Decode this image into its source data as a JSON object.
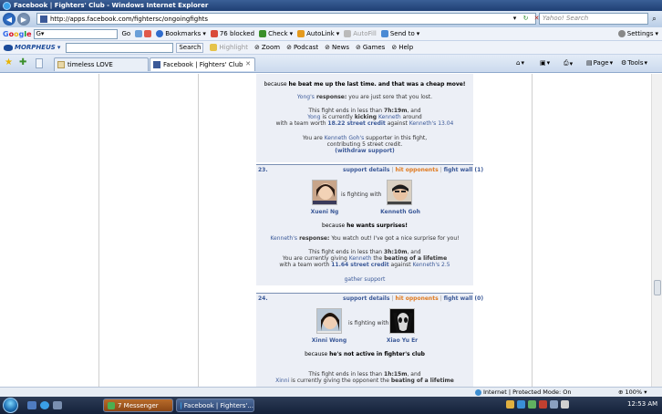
{
  "window": {
    "title": "Facebook | Fighters' Club - Windows Internet Explorer"
  },
  "address_bar": {
    "url": "http://apps.facebook.com/fightersc/ongoingfights",
    "search_placeholder": "Yahoo! Search"
  },
  "google_toolbar": {
    "go_label": "Go",
    "bookmarks_label": "Bookmarks",
    "blocked_label": "76 blocked",
    "check_label": "Check",
    "autolink_label": "AutoLink",
    "autofill_label": "AutoFill",
    "sendto_label": "Send to",
    "settings_label": "Settings"
  },
  "morpheus_toolbar": {
    "brand": "MORPHEUS",
    "search_label": "Search",
    "highlight_label": "Highlight",
    "zoom_label": "Zoom",
    "podcast_label": "Podcast",
    "news_label": "News",
    "games_label": "Games",
    "help_label": "Help"
  },
  "tabs": [
    {
      "label": "timeless LOVE"
    },
    {
      "label": "Facebook | Fighters' Club"
    }
  ],
  "command_bar": {
    "page_label": "Page",
    "tools_label": "Tools"
  },
  "entry22": {
    "reason_prefix": "because ",
    "reason": "he beat me up the last time. and that was a cheap move!",
    "responder": "Yong's",
    "response_label": " response:",
    "response_text": " you are just sore that you lost.",
    "ends_prefix": "This fight ends in less than ",
    "ends_time": "7h:19m",
    "ends_suffix": ", and",
    "fighter": "Yong",
    "mid1": " is currently ",
    "action": "kicking",
    "opponent": " Kenneth",
    "tail": " around",
    "team_prefix": "with a team worth ",
    "credit": "18.22 street credit",
    "against": " against ",
    "opp_credit": "Kenneth's 13.04",
    "supporter_prefix": "You are ",
    "supporter_of": "Kenneth Goh's",
    "supporter_suffix": " supporter in this fight,",
    "contributing": "contributing 5 street credit.",
    "withdraw_label": "(withdraw support)"
  },
  "entry23": {
    "number": "23.",
    "links": {
      "details": "support details",
      "hit": "hit opponents",
      "wall": "fight wall (1)"
    },
    "left_name": "Xueni Ng",
    "is_fighting": "is fighting with",
    "right_name": "Kenneth Goh",
    "reason_prefix": "because ",
    "reason": "he wants surprises!",
    "responder": "Kenneth's",
    "response_label": " response:",
    "response_text": " You watch out! I've got a nice surprise for you!",
    "ends_prefix": "This fight ends in less than ",
    "ends_time": "3h:10m",
    "ends_suffix": ", and",
    "giving_prefix": "You are currently giving ",
    "giving_target": "Kenneth",
    "giving_mid": " the ",
    "giving_action": "beating of a lifetime",
    "team_prefix": "with a team worth ",
    "credit": "11.64 street credit",
    "against": " against ",
    "opp_credit": "Kenneth's 2.5",
    "gather_label": "gather support"
  },
  "entry24": {
    "number": "24.",
    "links": {
      "details": "support details",
      "hit": "hit opponents",
      "wall": "fight wall (0)"
    },
    "left_name": "Xinni Wong",
    "is_fighting": "is fighting with",
    "right_name": "Xiao Yu Er",
    "reason_prefix": "because ",
    "reason": "he's not active in fighter's club",
    "ends_prefix": "This fight ends in less than ",
    "ends_time": "1h:15m",
    "ends_suffix": ", and",
    "fighter": "Xinni",
    "giving_text": " is currently giving the opponent the ",
    "giving_action": "beating of a lifetime"
  },
  "status_bar": {
    "zone": "Internet | Protected Mode: On",
    "zoom": "100%"
  },
  "taskbar": {
    "buttons": [
      {
        "label": "7 Messenger"
      },
      {
        "label": "Facebook | Fighters'..."
      }
    ],
    "clock": "12:53 AM"
  },
  "colors": {
    "fb_blue": "#3b5998",
    "accent_orange": "#e07a1f",
    "card_bg": "#eceff6"
  }
}
